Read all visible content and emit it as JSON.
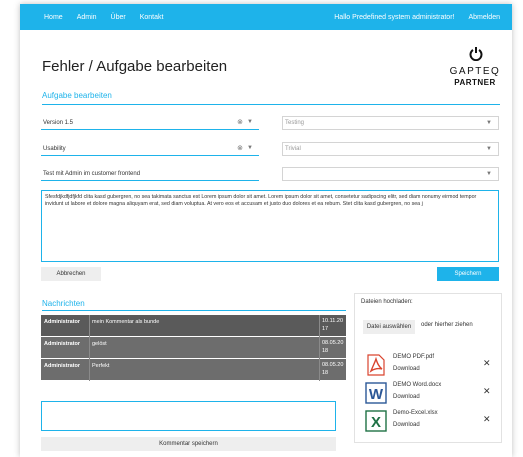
{
  "nav": {
    "links": [
      "Home",
      "Admin",
      "Über",
      "Kontakt"
    ],
    "greeting": "Hallo Predefined system administrator!",
    "logout": "Abmelden"
  },
  "page": {
    "title": "Fehler / Aufgabe bearbeiten"
  },
  "logo": {
    "brand": "GAPTEQ",
    "sub": "PARTNER"
  },
  "form": {
    "heading": "Aufgabe bearbeiten",
    "version": "Version 1.5",
    "type": "Testing",
    "category": "Usability",
    "priority": "Trivial",
    "title_value": "Test mit Admin im customer frontend",
    "empty_select": "",
    "description": "Sfesfdjkdfjdfjkfd clita kasd gubergren, no sea takimata sanctus est Lorem ipsum dolor sit amet. Lorem ipsum dolor sit amet, consetetur sadipscing elitr, sed diam nonumy eirmod tempor invidunt ut labore et dolore magna aliquyam erat, sed diam voluptua. At vero eos et accusam et justo duo dolores et ea rebum. Stet clita kasd gubergren, no sea j",
    "cancel_label": "Abbrechen",
    "save_label": "Speichern"
  },
  "messages": {
    "heading": "Nachrichten",
    "rows": [
      {
        "author": "Administrator",
        "text": "mein Kommentar als bunde",
        "date": "10.11.20 17"
      },
      {
        "author": "Administrator",
        "text": "gelöst",
        "date": "08.05.20 18"
      },
      {
        "author": "Administrator",
        "text": "Perfekt",
        "date": "08.05.20 18"
      }
    ],
    "comment_value": "",
    "save_comment_label": "Kommentar speichern"
  },
  "upload": {
    "title": "Dateien hochladen:",
    "choose_label": "Datei auswählen",
    "drag_text": "oder hierher ziehen",
    "files": [
      {
        "name": "DEMO PDF.pdf",
        "download": "Download",
        "icon": "pdf-icon",
        "color": "#d9442e"
      },
      {
        "name": "DEMO Word.docx",
        "download": "Download",
        "icon": "word-icon",
        "color": "#2b5797"
      },
      {
        "name": "Demo-Excel.xlsx",
        "download": "Download",
        "icon": "excel-icon",
        "color": "#1e7145"
      }
    ]
  },
  "colors": {
    "accent": "#1eb3ea",
    "table_bg": "#6d6d6d"
  }
}
